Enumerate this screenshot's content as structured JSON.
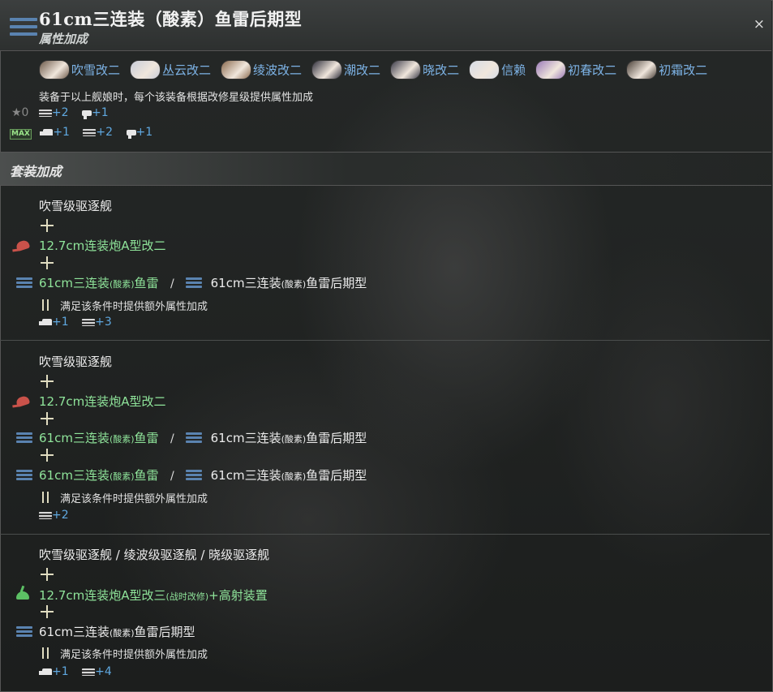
{
  "header": {
    "title": "61cm三连装（酸素）鱼雷后期型",
    "subtitle": "属性加成",
    "close_label": "×"
  },
  "ships": [
    {
      "name": "吹雪改二",
      "avatar_color": "#6d5a4a"
    },
    {
      "name": "丛云改二",
      "avatar_color": "#c8ccd8"
    },
    {
      "name": "绫波改二",
      "avatar_color": "#8a6a4e"
    },
    {
      "name": "潮改二",
      "avatar_color": "#2d2d3a"
    },
    {
      "name": "晓改二",
      "avatar_color": "#3a3a48"
    },
    {
      "name": "信赖",
      "avatar_color": "#d6dce6"
    },
    {
      "name": "初春改二",
      "avatar_color": "#9a7ab8"
    },
    {
      "name": "初霜改二",
      "avatar_color": "#4a4038"
    }
  ],
  "note": "装备于以上舰娘时，每个该装备根据改修星级提供属性加成",
  "star_level": {
    "label": "★0",
    "bonuses": [
      {
        "icon": "torpedo-stat-icon",
        "value": "+2"
      },
      {
        "icon": "hit-stat-icon",
        "value": "+1"
      }
    ]
  },
  "max_level": {
    "label": "MAX",
    "bonuses": [
      {
        "icon": "evasion-stat-icon",
        "value": "+1"
      },
      {
        "icon": "torpedo-stat-icon",
        "value": "+2"
      },
      {
        "icon": "hit-stat-icon",
        "value": "+1"
      }
    ]
  },
  "set_section_title": "套装加成",
  "sets": [
    {
      "ship_class": "吹雪级驱逐舰",
      "gun": "12.7cm连装炮A型改二",
      "torp_a_main": "61cm三连装",
      "torp_a_small": "(酸素)",
      "torp_a_end": "鱼雷",
      "slash": "/",
      "torp_b_main": "61cm三连装",
      "torp_b_small": "(酸素)",
      "torp_b_end": "鱼雷后期型",
      "condition": "满足该条件时提供额外属性加成",
      "bonus_1": "+1",
      "bonus_2": "+3"
    },
    {
      "ship_class": "吹雪级驱逐舰",
      "gun": "12.7cm连装炮A型改二",
      "torp_a_main": "61cm三连装",
      "torp_a_small": "(酸素)",
      "torp_a_end": "鱼雷",
      "slash": "/",
      "torp_b_main": "61cm三连装",
      "torp_b_small": "(酸素)",
      "torp_b_end": "鱼雷后期型",
      "condition": "满足该条件时提供额外属性加成",
      "bonus_1": "+2"
    },
    {
      "ship_class": "吹雪级驱逐舰 / 绫波级驱逐舰 / 晓级驱逐舰",
      "gun_main": "12.7cm连装炮A型改三",
      "gun_small": "(战时改修)",
      "gun_end": "+高射装置",
      "torp_main": "61cm三连装",
      "torp_small": "(酸素)",
      "torp_end": "鱼雷后期型",
      "condition": "满足该条件时提供额外属性加成",
      "bonus_1": "+1",
      "bonus_2": "+4"
    }
  ],
  "colors": {
    "ship_name": "#7db3e6",
    "equip_green": "#8fe49a",
    "stat_value": "#5fa8e0",
    "torpedo_icon": "#5a83b0",
    "gun_icon": "#c9524a",
    "aa_gun_icon": "#5cc064"
  }
}
